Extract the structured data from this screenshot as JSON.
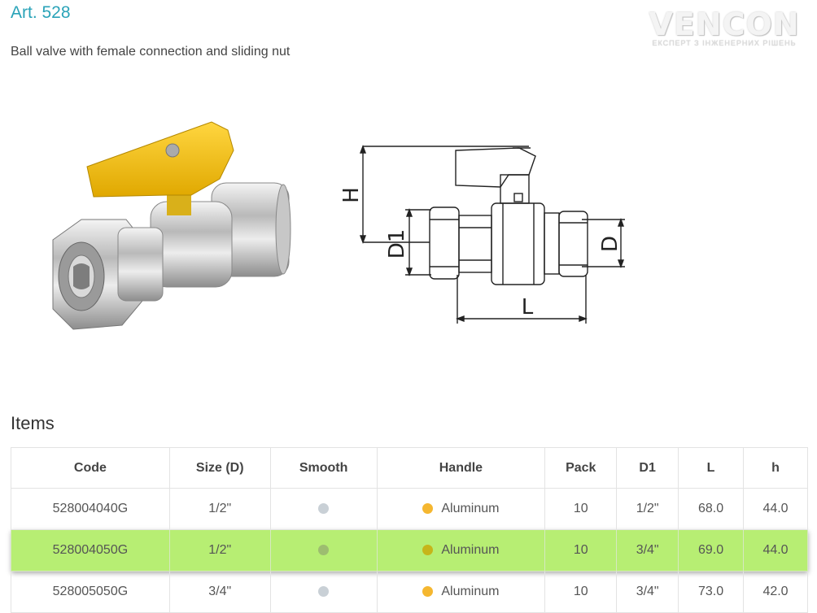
{
  "product": {
    "title": "Art. 528",
    "subtitle": "Ball valve with female connection and sliding nut"
  },
  "logo": {
    "name": "VENCON",
    "tagline": "ЕКСПЕРТ З ІНЖЕНЕРНИХ РІШЕНЬ"
  },
  "drawing_labels": {
    "h": "H",
    "d1": "D1",
    "d": "D",
    "l": "L"
  },
  "items": {
    "heading": "Items",
    "columns": [
      "Code",
      "Size (D)",
      "Smooth",
      "Handle",
      "Pack",
      "D1",
      "L",
      "h"
    ],
    "rows": [
      {
        "code": "528004040G",
        "size": "1/2\"",
        "smooth_color": "#c9d0d6",
        "handle_color": "#f5b730",
        "handle": "Aluminum",
        "pack": "10",
        "d1": "1/2\"",
        "l": "68.0",
        "h": "44.0",
        "highlighted": false
      },
      {
        "code": "528004050G",
        "size": "1/2\"",
        "smooth_color": "#9dbd70",
        "handle_color": "#c6b51a",
        "handle": "Aluminum",
        "pack": "10",
        "d1": "3/4\"",
        "l": "69.0",
        "h": "44.0",
        "highlighted": true
      },
      {
        "code": "528005050G",
        "size": "3/4\"",
        "smooth_color": "#c9d0d6",
        "handle_color": "#f5b730",
        "handle": "Aluminum",
        "pack": "10",
        "d1": "3/4\"",
        "l": "73.0",
        "h": "42.0",
        "highlighted": false
      }
    ]
  },
  "colors": {
    "accent": "#2aa3b8",
    "highlight_row": "#b7ee73",
    "handle_yellow": "#f5c418"
  }
}
